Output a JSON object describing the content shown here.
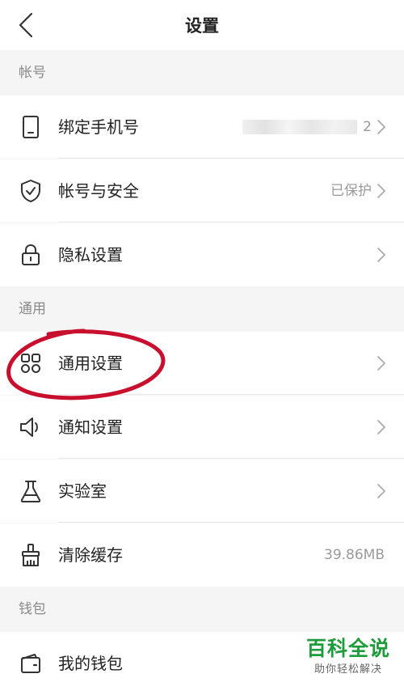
{
  "header": {
    "title": "设置"
  },
  "sections": [
    {
      "label": "帐号",
      "items": [
        {
          "label": "绑定手机号",
          "value": "2",
          "chevron": true,
          "icon": "phone-icon"
        },
        {
          "label": "帐号与安全",
          "value": "已保护",
          "chevron": true,
          "icon": "shield-icon"
        },
        {
          "label": "隐私设置",
          "value": "",
          "chevron": true,
          "icon": "lock-icon"
        }
      ]
    },
    {
      "label": "通用",
      "items": [
        {
          "label": "通用设置",
          "value": "",
          "chevron": true,
          "icon": "grid-icon"
        },
        {
          "label": "通知设置",
          "value": "",
          "chevron": true,
          "icon": "speaker-icon"
        },
        {
          "label": "实验室",
          "value": "",
          "chevron": true,
          "icon": "flask-icon"
        },
        {
          "label": "清除缓存",
          "value": "39.86MB",
          "chevron": false,
          "icon": "broom-icon"
        }
      ]
    },
    {
      "label": "钱包",
      "items": [
        {
          "label": "我的钱包",
          "value": "",
          "chevron": false,
          "icon": "wallet-icon"
        }
      ]
    }
  ],
  "watermark": {
    "title": "百科全说",
    "subtitle": "助你轻松解决"
  },
  "colors": {
    "annotation": "#c8102e",
    "watermark": "#1e9b3b",
    "muted": "#8a8a8a"
  }
}
